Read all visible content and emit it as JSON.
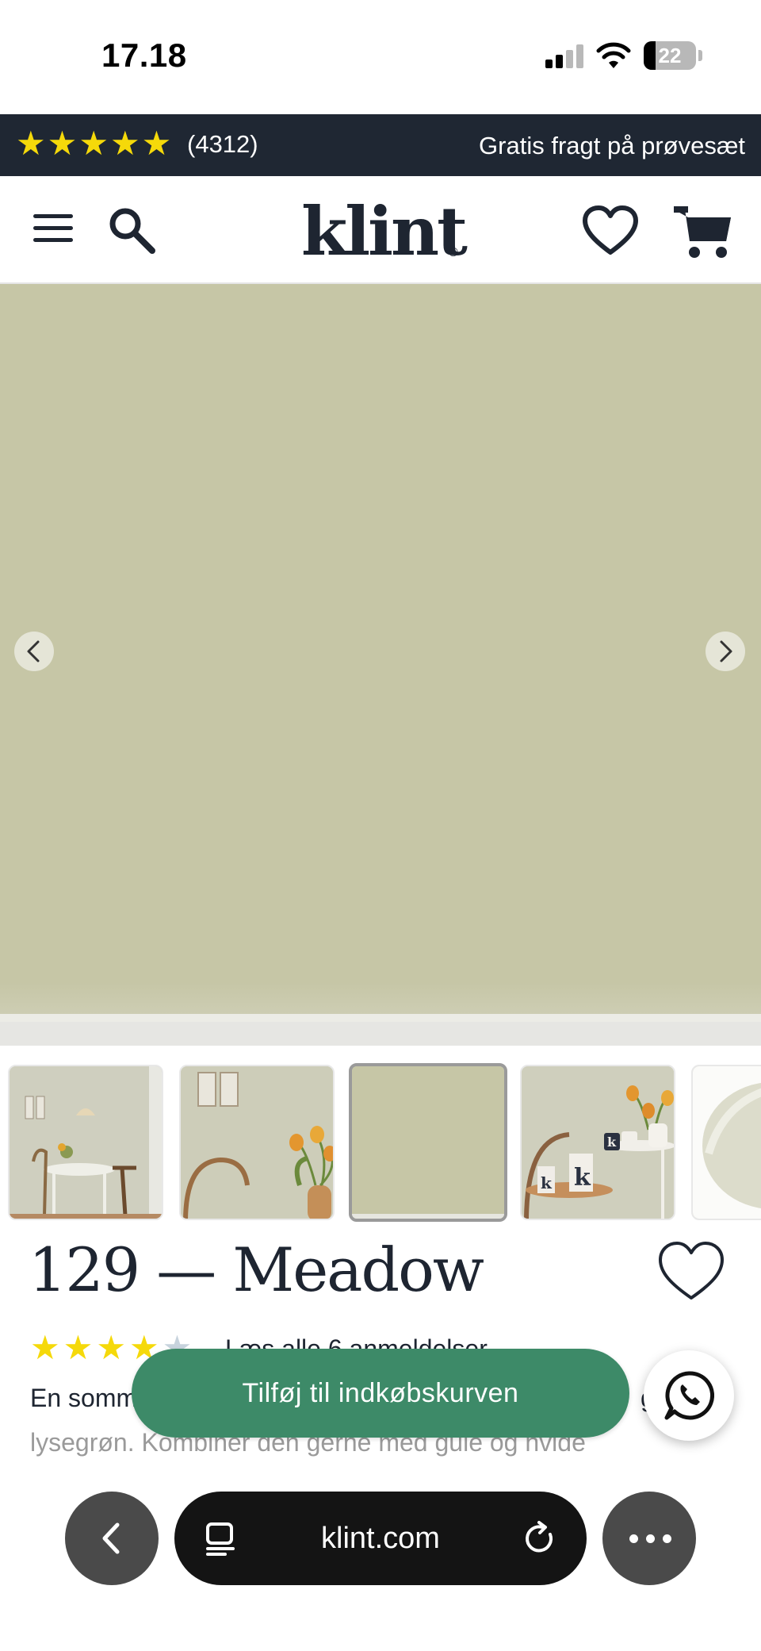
{
  "status_bar": {
    "time": "17.18",
    "battery": "22",
    "battery_level": 0.22
  },
  "promo": {
    "rating_stars": 5,
    "review_count": "(4312)",
    "shipping_text": "Gratis fragt på prøvesæt"
  },
  "header": {
    "logo": "klint",
    "logo_mark": "®",
    "icons": [
      "menu-icon",
      "search-icon",
      "heart-icon",
      "cart-icon"
    ]
  },
  "hero": {
    "swatch_color": "#c6c6a6",
    "prev_icon": "chevron-left-icon",
    "next_icon": "chevron-right-icon"
  },
  "thumbnails": {
    "count_visible": 5,
    "selected_index": 2
  },
  "product": {
    "title": "129 — Meadow",
    "rating": 4.5,
    "reviews_link": "Læs alle 6 anmeldelser",
    "description_line1": "En somm",
    "description_line1_end": "g",
    "description_line2": "lysegrøn. Kombiner den gerne med gule og hvide"
  },
  "cta": {
    "add_to_cart": "Tilføj til indkøbskurven",
    "button_color": "#3d8a68",
    "whatsapp_icon": "whatsapp-icon"
  },
  "browser": {
    "url": "klint.com",
    "back_icon": "chevron-left-icon",
    "reader_icon": "reader-icon",
    "reload_icon": "reload-icon",
    "more_icon": "more-icon"
  },
  "colors": {
    "navy": "#1f2733",
    "star_yellow": "#f5d90a",
    "brand_green": "#3d8a68"
  }
}
